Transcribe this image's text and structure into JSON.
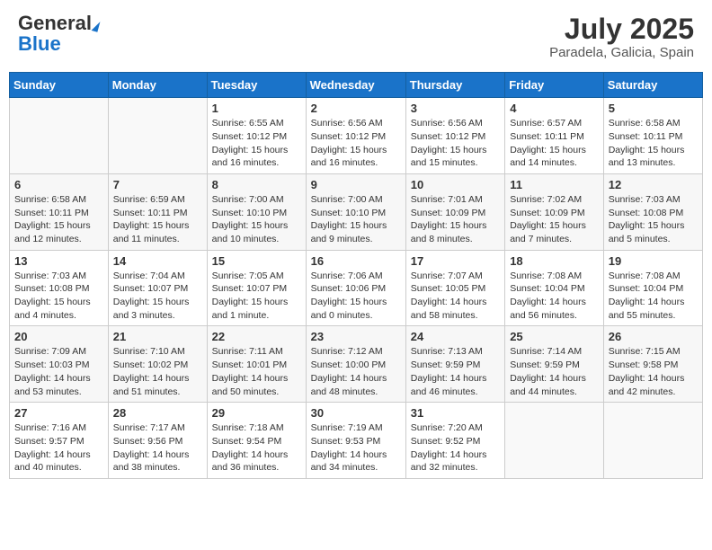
{
  "header": {
    "logo_general": "General",
    "logo_blue": "Blue",
    "title": "July 2025",
    "location": "Paradela, Galicia, Spain"
  },
  "days_of_week": [
    "Sunday",
    "Monday",
    "Tuesday",
    "Wednesday",
    "Thursday",
    "Friday",
    "Saturday"
  ],
  "weeks": [
    [
      {
        "day": "",
        "content": ""
      },
      {
        "day": "",
        "content": ""
      },
      {
        "day": "1",
        "content": "Sunrise: 6:55 AM\nSunset: 10:12 PM\nDaylight: 15 hours and 16 minutes."
      },
      {
        "day": "2",
        "content": "Sunrise: 6:56 AM\nSunset: 10:12 PM\nDaylight: 15 hours and 16 minutes."
      },
      {
        "day": "3",
        "content": "Sunrise: 6:56 AM\nSunset: 10:12 PM\nDaylight: 15 hours and 15 minutes."
      },
      {
        "day": "4",
        "content": "Sunrise: 6:57 AM\nSunset: 10:11 PM\nDaylight: 15 hours and 14 minutes."
      },
      {
        "day": "5",
        "content": "Sunrise: 6:58 AM\nSunset: 10:11 PM\nDaylight: 15 hours and 13 minutes."
      }
    ],
    [
      {
        "day": "6",
        "content": "Sunrise: 6:58 AM\nSunset: 10:11 PM\nDaylight: 15 hours and 12 minutes."
      },
      {
        "day": "7",
        "content": "Sunrise: 6:59 AM\nSunset: 10:11 PM\nDaylight: 15 hours and 11 minutes."
      },
      {
        "day": "8",
        "content": "Sunrise: 7:00 AM\nSunset: 10:10 PM\nDaylight: 15 hours and 10 minutes."
      },
      {
        "day": "9",
        "content": "Sunrise: 7:00 AM\nSunset: 10:10 PM\nDaylight: 15 hours and 9 minutes."
      },
      {
        "day": "10",
        "content": "Sunrise: 7:01 AM\nSunset: 10:09 PM\nDaylight: 15 hours and 8 minutes."
      },
      {
        "day": "11",
        "content": "Sunrise: 7:02 AM\nSunset: 10:09 PM\nDaylight: 15 hours and 7 minutes."
      },
      {
        "day": "12",
        "content": "Sunrise: 7:03 AM\nSunset: 10:08 PM\nDaylight: 15 hours and 5 minutes."
      }
    ],
    [
      {
        "day": "13",
        "content": "Sunrise: 7:03 AM\nSunset: 10:08 PM\nDaylight: 15 hours and 4 minutes."
      },
      {
        "day": "14",
        "content": "Sunrise: 7:04 AM\nSunset: 10:07 PM\nDaylight: 15 hours and 3 minutes."
      },
      {
        "day": "15",
        "content": "Sunrise: 7:05 AM\nSunset: 10:07 PM\nDaylight: 15 hours and 1 minute."
      },
      {
        "day": "16",
        "content": "Sunrise: 7:06 AM\nSunset: 10:06 PM\nDaylight: 15 hours and 0 minutes."
      },
      {
        "day": "17",
        "content": "Sunrise: 7:07 AM\nSunset: 10:05 PM\nDaylight: 14 hours and 58 minutes."
      },
      {
        "day": "18",
        "content": "Sunrise: 7:08 AM\nSunset: 10:04 PM\nDaylight: 14 hours and 56 minutes."
      },
      {
        "day": "19",
        "content": "Sunrise: 7:08 AM\nSunset: 10:04 PM\nDaylight: 14 hours and 55 minutes."
      }
    ],
    [
      {
        "day": "20",
        "content": "Sunrise: 7:09 AM\nSunset: 10:03 PM\nDaylight: 14 hours and 53 minutes."
      },
      {
        "day": "21",
        "content": "Sunrise: 7:10 AM\nSunset: 10:02 PM\nDaylight: 14 hours and 51 minutes."
      },
      {
        "day": "22",
        "content": "Sunrise: 7:11 AM\nSunset: 10:01 PM\nDaylight: 14 hours and 50 minutes."
      },
      {
        "day": "23",
        "content": "Sunrise: 7:12 AM\nSunset: 10:00 PM\nDaylight: 14 hours and 48 minutes."
      },
      {
        "day": "24",
        "content": "Sunrise: 7:13 AM\nSunset: 9:59 PM\nDaylight: 14 hours and 46 minutes."
      },
      {
        "day": "25",
        "content": "Sunrise: 7:14 AM\nSunset: 9:59 PM\nDaylight: 14 hours and 44 minutes."
      },
      {
        "day": "26",
        "content": "Sunrise: 7:15 AM\nSunset: 9:58 PM\nDaylight: 14 hours and 42 minutes."
      }
    ],
    [
      {
        "day": "27",
        "content": "Sunrise: 7:16 AM\nSunset: 9:57 PM\nDaylight: 14 hours and 40 minutes."
      },
      {
        "day": "28",
        "content": "Sunrise: 7:17 AM\nSunset: 9:56 PM\nDaylight: 14 hours and 38 minutes."
      },
      {
        "day": "29",
        "content": "Sunrise: 7:18 AM\nSunset: 9:54 PM\nDaylight: 14 hours and 36 minutes."
      },
      {
        "day": "30",
        "content": "Sunrise: 7:19 AM\nSunset: 9:53 PM\nDaylight: 14 hours and 34 minutes."
      },
      {
        "day": "31",
        "content": "Sunrise: 7:20 AM\nSunset: 9:52 PM\nDaylight: 14 hours and 32 minutes."
      },
      {
        "day": "",
        "content": ""
      },
      {
        "day": "",
        "content": ""
      }
    ]
  ]
}
